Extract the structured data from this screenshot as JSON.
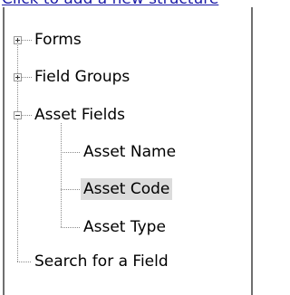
{
  "header": {
    "link_text": "Click to add a new structure"
  },
  "tree": {
    "nodes": [
      {
        "label": "Forms",
        "toggle": "plus"
      },
      {
        "label": "Field Groups",
        "toggle": "plus"
      },
      {
        "label": "Asset Fields",
        "toggle": "minus",
        "children": [
          {
            "label": "Asset Name"
          },
          {
            "label": "Asset Code",
            "selected": true
          },
          {
            "label": "Asset Type"
          }
        ]
      },
      {
        "label": "Search for a Field"
      }
    ]
  }
}
